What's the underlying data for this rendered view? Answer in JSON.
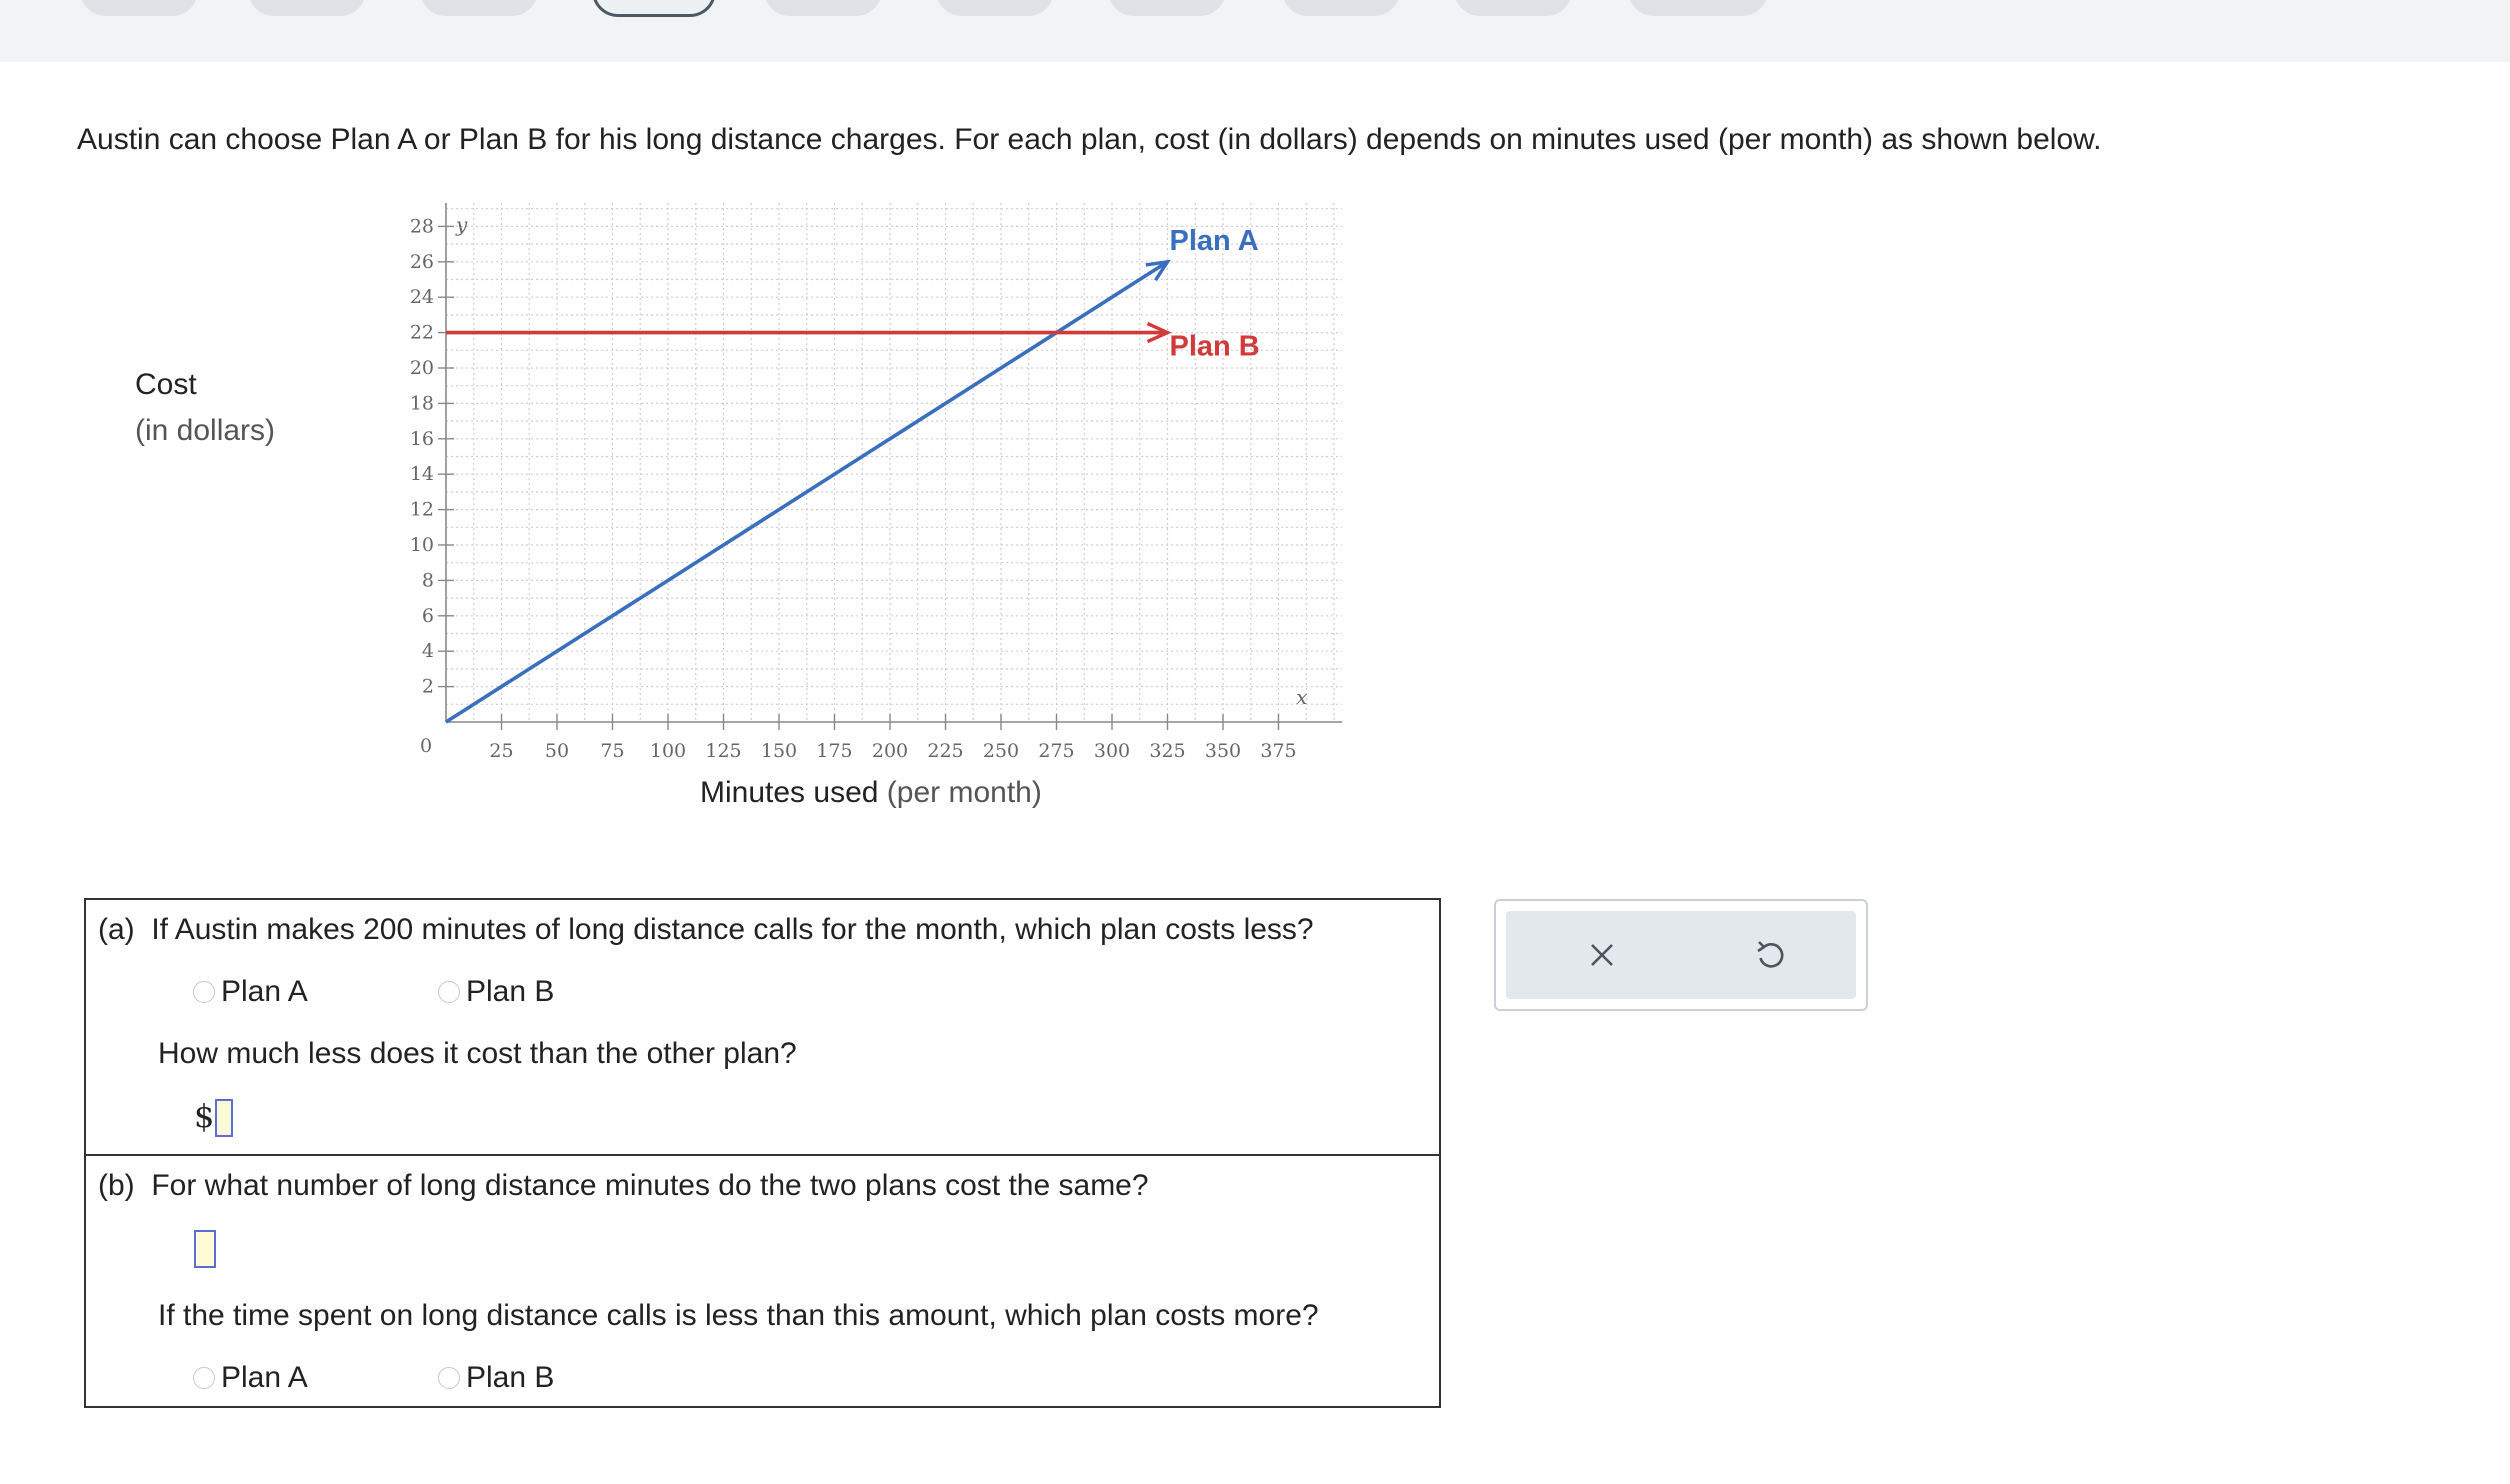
{
  "problem": {
    "intro": "Austin can choose Plan A or Plan B for his long distance charges. For each plan, cost (in dollars) depends on minutes used (per month) as shown below."
  },
  "chart_data": {
    "type": "line",
    "ylabel_main": "Cost",
    "ylabel_paren": "(in dollars)",
    "xlabel_main": "Minutes used",
    "xlabel_paren": "(per month)",
    "x_var": "x",
    "y_var": "y",
    "origin_label": "0",
    "xlim": [
      0,
      400
    ],
    "ylim": [
      0,
      28
    ],
    "x_ticks": [
      25,
      50,
      75,
      100,
      125,
      150,
      175,
      200,
      225,
      250,
      275,
      300,
      325,
      350,
      375
    ],
    "y_ticks": [
      2,
      4,
      6,
      8,
      10,
      12,
      14,
      16,
      18,
      20,
      22,
      24,
      26,
      28
    ],
    "grid": true,
    "series": [
      {
        "name": "Plan A",
        "color": "#3a6fbf",
        "x": [
          0,
          325
        ],
        "y": [
          0,
          26
        ]
      },
      {
        "name": "Plan B",
        "color": "#d23a3a",
        "x": [
          0,
          325
        ],
        "y": [
          22,
          22
        ]
      }
    ]
  },
  "part_a": {
    "label": "(a)",
    "question": "If Austin makes 200 minutes of long distance calls for the month, which plan costs less?",
    "options": [
      "Plan A",
      "Plan B"
    ],
    "followup": "How much less does it cost than the other plan?",
    "currency": "$"
  },
  "part_b": {
    "label": "(b)",
    "question": "For what number of long distance minutes do the two plans cost the same?",
    "followup": "If the time spent on long distance calls is less than this amount, which plan costs more?",
    "options": [
      "Plan A",
      "Plan B"
    ]
  },
  "tools": {
    "clear_icon": "close-icon",
    "undo_icon": "undo-icon"
  }
}
